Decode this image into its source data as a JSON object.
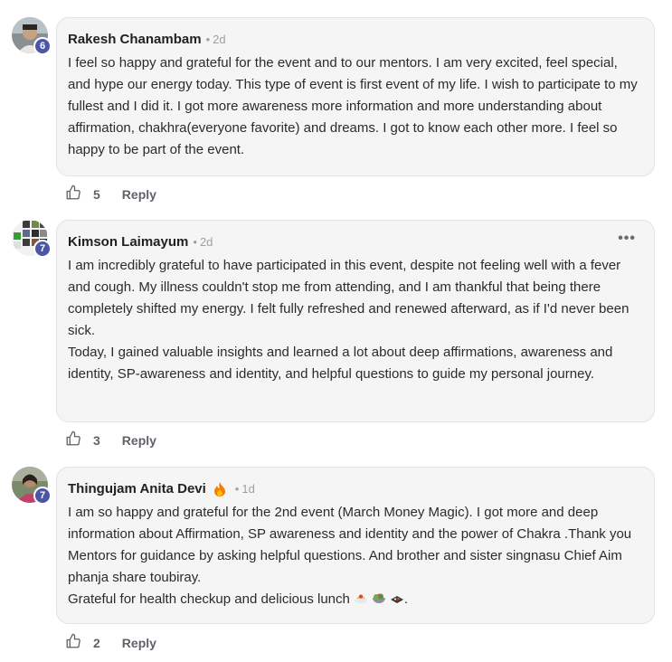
{
  "comments": [
    {
      "author": "Rakesh Chanambam",
      "separator": "•",
      "time": "2d",
      "level": "6",
      "paragraphs": [
        "I feel so happy and grateful for the event and to our mentors. I am very excited, feel special, and hype our energy today. This type of event is first event of my life. I wish to participate to my fullest and I did it. I got more awareness more information and more understanding about affirmation, chakhra(everyone favorite) and dreams. I got to know each other more. I feel so happy to be part of the event."
      ],
      "likes": "5",
      "reply_label": "Reply"
    },
    {
      "author": "Kimson Laimayum",
      "separator": "•",
      "time": "2d",
      "level": "7",
      "more_label": "•••",
      "paragraphs": [
        "I am incredibly grateful to have participated in this event, despite not feeling well with a fever and cough. My illness couldn't stop me from attending, and I am thankful that being there completely shifted my energy. I felt fully refreshed and renewed afterward, as if I'd never been sick.",
        "Today, I gained valuable insights and learned a lot about deep affirmations, awareness and identity, SP-awareness and identity, and helpful questions to guide my personal journey."
      ],
      "likes": "3",
      "reply_label": "Reply"
    },
    {
      "author": "Thingujam Anita Devi",
      "separator": "•",
      "time": "1d",
      "level": "7",
      "paragraphs": [
        "I am so happy and grateful for the 2nd event (March Money Magic). I got more and deep information about Affirmation, SP awareness and identity and the power of Chakra .Thank you Mentors for guidance by asking helpful questions. And brother and sister singnasu Chief Aim phanja share toubiray.",
        "Grateful for health checkup and delicious lunch"
      ],
      "trailing_text": ".",
      "likes": "2",
      "reply_label": "Reply"
    }
  ],
  "icons": {
    "like": "thumbs-up-outline-icon",
    "flame": "fire-icon",
    "emojis": [
      "spaghetti-icon",
      "salad-icon",
      "bento-box-icon"
    ]
  },
  "colors": {
    "level_badge": "#4a56a6",
    "bubble_bg": "#f5f5f5",
    "meta_gray": "#9aa0a6"
  }
}
